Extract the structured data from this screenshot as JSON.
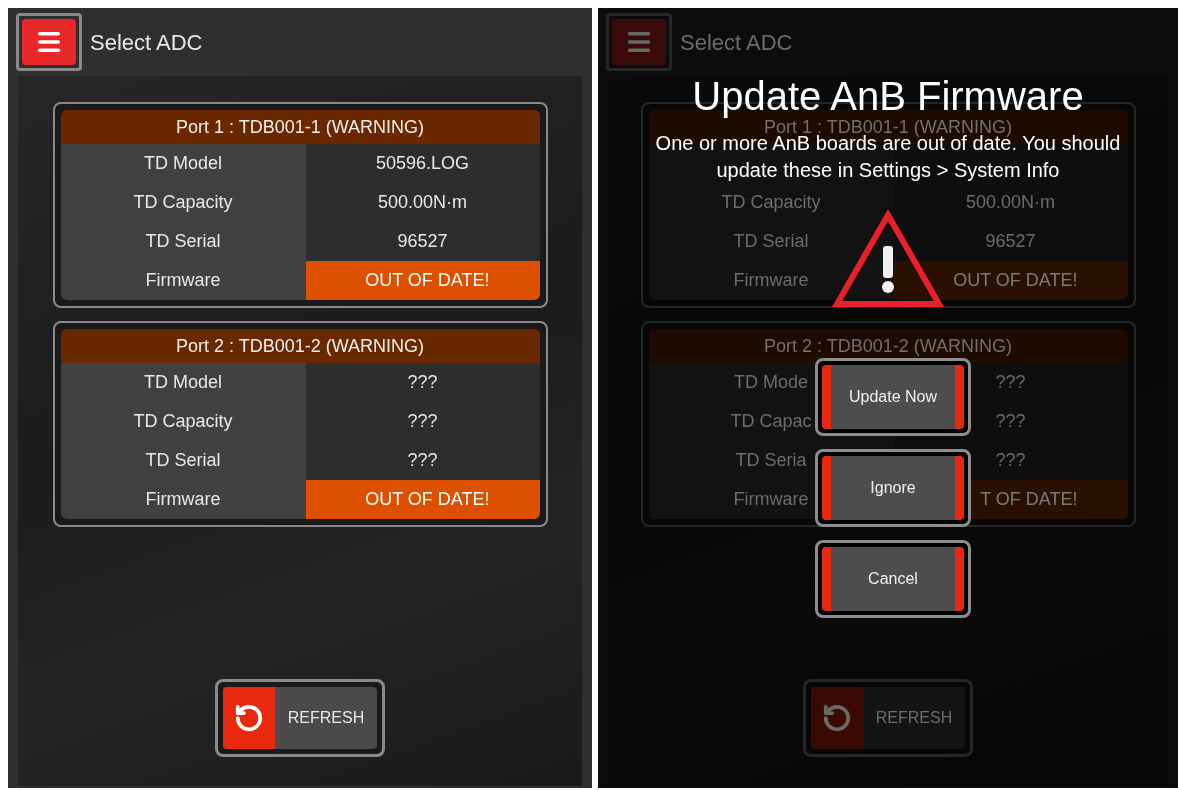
{
  "screens": [
    {
      "dimmed": false,
      "header": {
        "title": "Select ADC"
      },
      "ports": [
        {
          "title": "Port 1 : TDB001-1 (WARNING)",
          "rows": [
            {
              "label": "TD Model",
              "value": "50596.LOG",
              "kind": "info"
            },
            {
              "label": "TD Capacity",
              "value": "500.00N·m",
              "kind": "info"
            },
            {
              "label": "TD Serial",
              "value": "96527",
              "kind": "info"
            },
            {
              "label": "Firmware",
              "value": "OUT OF DATE!",
              "kind": "alert"
            }
          ]
        },
        {
          "title": "Port 2 : TDB001-2 (WARNING)",
          "rows": [
            {
              "label": "TD Model",
              "value": "???",
              "kind": "info"
            },
            {
              "label": "TD Capacity",
              "value": "???",
              "kind": "info"
            },
            {
              "label": "TD Serial",
              "value": "???",
              "kind": "info"
            },
            {
              "label": "Firmware",
              "value": "OUT OF DATE!",
              "kind": "alert"
            }
          ]
        }
      ],
      "refresh": {
        "label": "REFRESH"
      }
    },
    {
      "dimmed": true,
      "header": {
        "title": "Select ADC"
      },
      "ports": [
        {
          "title": "Port 1 : TDB001-1 (WARNING)",
          "rows": [
            {
              "kind": "info"
            },
            {
              "label": "TD Capacity",
              "value": "500.00N·m",
              "kind": "info"
            },
            {
              "label": "TD Serial",
              "value": "96527",
              "kind": "info"
            },
            {
              "label": "Firmware",
              "value": "OUT OF DATE!",
              "kind": "alert"
            }
          ]
        },
        {
          "title": "Port 2 : TDB001-2 (WARNING)",
          "rows": [
            {
              "label": "TD Mode",
              "value": "???",
              "kind": "info"
            },
            {
              "label": "TD Capac",
              "value": "???",
              "kind": "info"
            },
            {
              "label": "TD Seria",
              "value": "???",
              "kind": "info"
            },
            {
              "label": "Firmware",
              "value": "T OF DATE!",
              "kind": "alert"
            }
          ]
        }
      ],
      "refresh": {
        "label": "REFRESH"
      },
      "dialog": {
        "title": "Update AnB Firmware",
        "message": "One or more AnB boards are out of date. You should update these in Settings > System Info",
        "buttons": [
          "Update Now",
          "Ignore",
          "Cancel"
        ]
      }
    }
  ]
}
